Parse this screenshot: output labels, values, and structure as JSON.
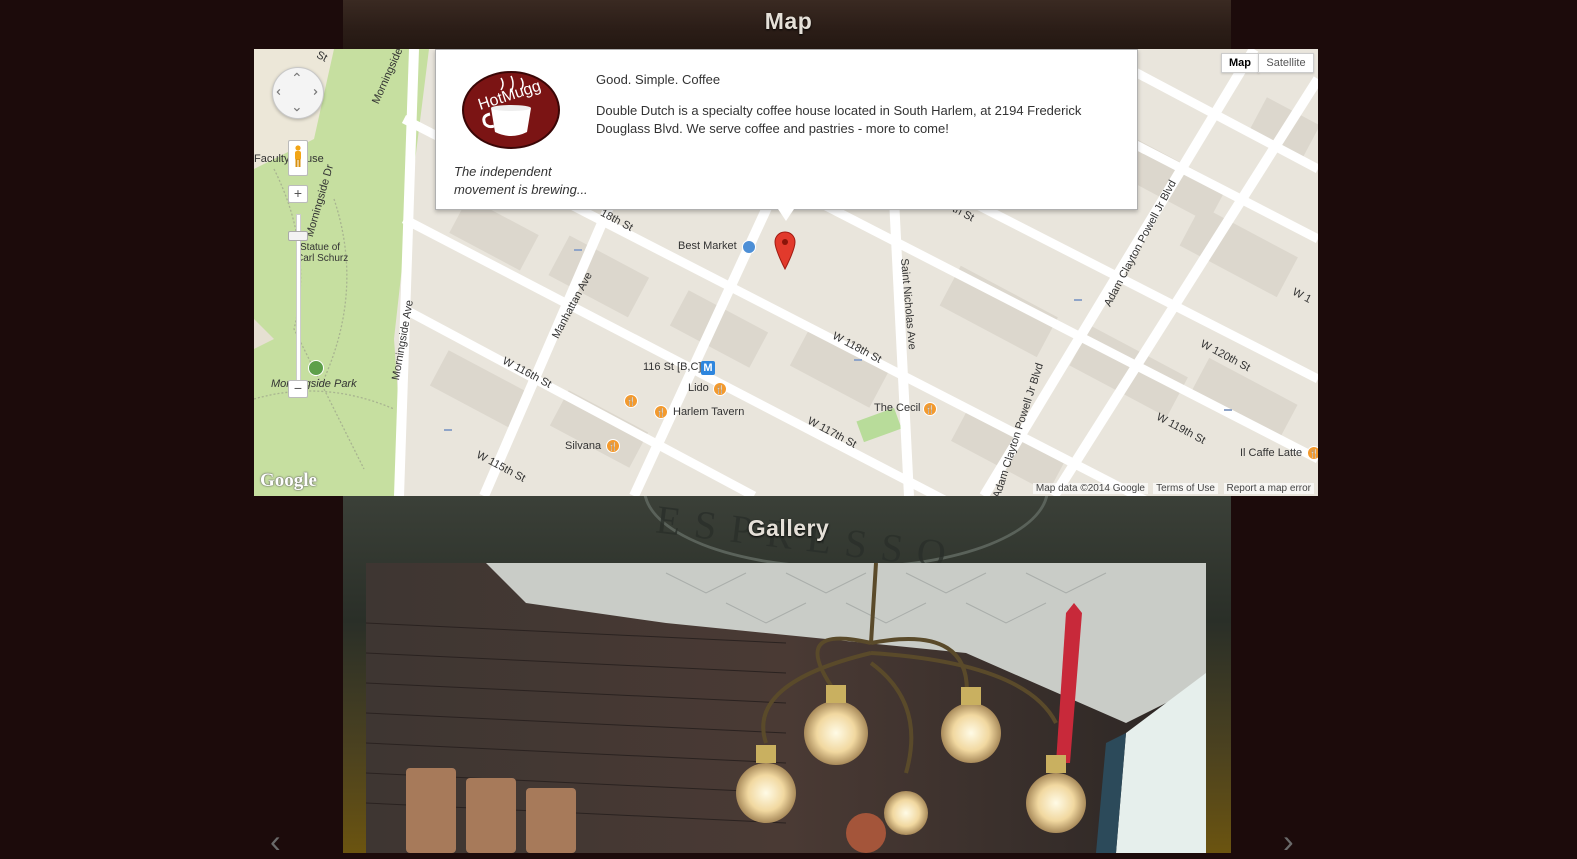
{
  "sections": {
    "map_title": "Map",
    "gallery_title": "Gallery"
  },
  "map": {
    "type_buttons": {
      "map": "Map",
      "satellite": "Satellite"
    },
    "zoom": {
      "in": "+",
      "out": "−"
    },
    "info_window": {
      "logo_text": "HotMugg",
      "tagline": "The independent movement is brewing...",
      "heading": "Good. Simple. Coffee",
      "description": "Double Dutch is a specialty coffee house located in South Harlem, at 2194 Frederick Douglass Blvd. We serve coffee and pastries - more to come!"
    },
    "streets": {
      "s1": "W 118th St",
      "s2": "W 116th St",
      "s3": "W 115th St",
      "s4": "W 117th St",
      "s5": "W 118th St",
      "s6": "W 120th St",
      "s7": "W 119th St",
      "s8": "Manhattan Ave",
      "s9": "Morningside Ave",
      "s10": "Morningside Dr",
      "s11": "Saint Nicholas Ave",
      "s12": "Adam Clayton Powell Jr Blvd",
      "s13": "Adam Clayton Powell Jr Blvd",
      "s14": "Morningside",
      "s15": "th St",
      "s16": "W 1",
      "s17": "18th St",
      "s18": "St"
    },
    "places": {
      "best_market": "Best Market",
      "station": "116 St [B,C]",
      "lido": "Lido",
      "harlem_tavern": "Harlem Tavern",
      "silvana": "Silvana",
      "the_cecil": "The Cecil",
      "il_caffe": "Il Caffe Latte",
      "faculty": "Faculty",
      "house": "use",
      "statue": "Statue of",
      "statue2": "Carl Schurz",
      "park": "Morningside Park"
    },
    "metro_symbol": "M",
    "google": "Google",
    "footer": {
      "data": "Map data ©2014 Google",
      "terms": "Terms of Use",
      "report": "Report a map error"
    }
  },
  "gallery": {
    "prev": "‹",
    "next": "›",
    "sign_text": "ESPRESSO"
  }
}
